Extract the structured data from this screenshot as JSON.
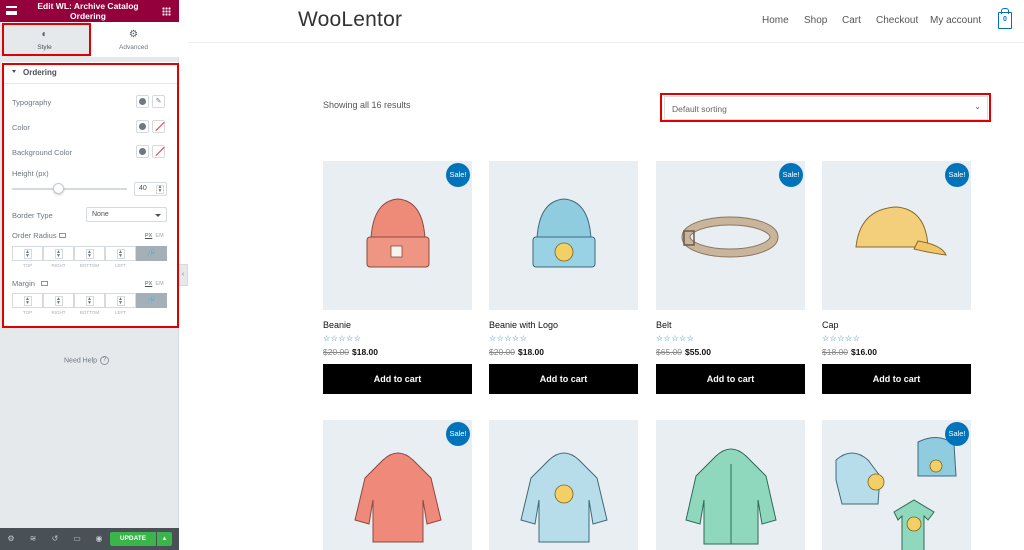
{
  "editor": {
    "title": "Edit WL: Archive Catalog Ordering",
    "tabs": [
      {
        "label": "Style",
        "icon": "contrast-icon"
      },
      {
        "label": "Advanced",
        "icon": "gear-icon"
      }
    ],
    "section": "Ordering",
    "controls": {
      "typography": "Typography",
      "color": "Color",
      "background_color": "Background Color",
      "height_label": "Height (px)",
      "height_value": "40",
      "height_slider_fraction": 0.4,
      "border_type_label": "Border Type",
      "border_type_value": "None",
      "order_radius_label": "Order Radius",
      "margin_label": "Margin",
      "unit_px": "PX",
      "unit_em": "EM",
      "dim_labels": [
        "TOP",
        "RIGHT",
        "BOTTOM",
        "LEFT"
      ]
    },
    "help": "Need Help",
    "update": "UPDATE"
  },
  "site": {
    "logo": "WooLentor",
    "nav": [
      "Home",
      "Shop",
      "Cart",
      "Checkout",
      "My account"
    ],
    "cart_count": "0",
    "results": "Showing all 16 results",
    "sorting": "Default sorting",
    "sale_badge": "Sale!",
    "add_to_cart": "Add to cart",
    "products": [
      {
        "name": "Beanie",
        "old_price": "$20.00",
        "price": "$18.00",
        "color": "#ee8a78",
        "image": "beanie"
      },
      {
        "name": "Beanie with Logo",
        "old_price": "$20.00",
        "price": "$18.00",
        "color": "#8fcce0",
        "image": "beanie-logo"
      },
      {
        "name": "Belt",
        "old_price": "$65.00",
        "price": "$55.00",
        "color": "#c9b49c",
        "image": "belt"
      },
      {
        "name": "Cap",
        "old_price": "$18.00",
        "price": "$16.00",
        "color": "#f3cf7c",
        "image": "cap"
      }
    ],
    "products_row2": [
      {
        "image": "hoodie",
        "color": "#ef8a7a",
        "sale": true
      },
      {
        "image": "hoodie-logo",
        "color": "#b7dcea",
        "sale": false
      },
      {
        "image": "hoodie-zipper",
        "color": "#8fd8bd",
        "sale": false
      },
      {
        "image": "logo-collection",
        "color": "#a8d6e8",
        "sale": true
      }
    ],
    "rating_stars": "☆☆☆☆☆"
  }
}
